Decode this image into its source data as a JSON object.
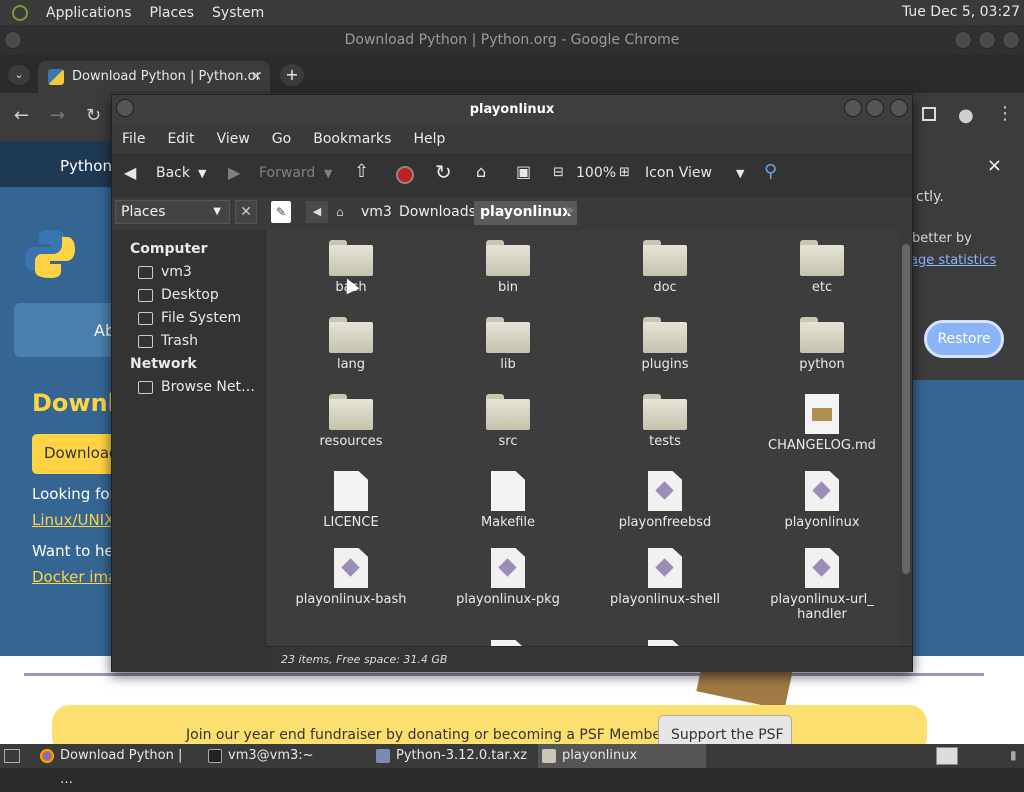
{
  "top_panel": {
    "menus": [
      "Applications",
      "Places",
      "System"
    ],
    "clock": "Tue Dec  5, 03:27"
  },
  "chrome": {
    "window_title": "Download Python | Python.org - Google Chrome",
    "tab_title": "Download Python | Python.or",
    "tab_close": "×",
    "new_tab": "+"
  },
  "python_page": {
    "nav": "Python",
    "about_btn": "Ab",
    "heading": "Downl",
    "download_btn": "Download",
    "looking_for": "Looking for",
    "link1": "Linux/UNIX,",
    "want_help": "Want to help",
    "link2": "Docker imag",
    "fundraiser_text": "Join our year end fundraiser by donating or becoming a PSF Member!",
    "support_btn": "Support the PSF"
  },
  "restore_popup": {
    "close": "×",
    "line1": "ctly.",
    "line2": "better by",
    "link": "age statistics",
    "button": "Restore"
  },
  "file_manager": {
    "title": "playonlinux",
    "menu": [
      "File",
      "Edit",
      "View",
      "Go",
      "Bookmarks",
      "Help"
    ],
    "toolbar": {
      "back": "Back",
      "forward": "Forward",
      "zoom": "100%",
      "view_mode": "Icon View"
    },
    "breadcrumb": [
      "vm3",
      "Downloads",
      "playonlinux"
    ],
    "sidebar": {
      "select_label": "Places",
      "close": "✕",
      "computer_header": "Computer",
      "computer_items": [
        "vm3",
        "Desktop",
        "File System",
        "Trash"
      ],
      "network_header": "Network",
      "network_items": [
        "Browse Net…"
      ]
    },
    "files": [
      {
        "name": "bash",
        "type": "folder"
      },
      {
        "name": "bin",
        "type": "folder"
      },
      {
        "name": "doc",
        "type": "folder"
      },
      {
        "name": "etc",
        "type": "folder"
      },
      {
        "name": "lang",
        "type": "folder"
      },
      {
        "name": "lib",
        "type": "folder"
      },
      {
        "name": "plugins",
        "type": "folder"
      },
      {
        "name": "python",
        "type": "folder"
      },
      {
        "name": "resources",
        "type": "folder"
      },
      {
        "name": "src",
        "type": "folder"
      },
      {
        "name": "tests",
        "type": "folder"
      },
      {
        "name": "CHANGELOG.md",
        "type": "image-doc"
      },
      {
        "name": "LICENCE",
        "type": "doc"
      },
      {
        "name": "Makefile",
        "type": "doc"
      },
      {
        "name": "playonfreebsd",
        "type": "script"
      },
      {
        "name": "playonlinux",
        "type": "script"
      },
      {
        "name": "playonlinux-bash",
        "type": "script"
      },
      {
        "name": "playonlinux-pkg",
        "type": "script"
      },
      {
        "name": "playonlinux-shell",
        "type": "script"
      },
      {
        "name": "playonlinux-url_\nhandler",
        "type": "script"
      }
    ],
    "status": "23 items, Free space: 31.4 GB"
  },
  "taskbar": {
    "items": [
      "Download Python | …",
      "vm3@vm3:~",
      "Python-3.12.0.tar.xz",
      "playonlinux"
    ]
  },
  "colors": {
    "accent_blue": "#8ab4f8",
    "python_yellow": "#ffd343",
    "python_blue": "#356592"
  }
}
